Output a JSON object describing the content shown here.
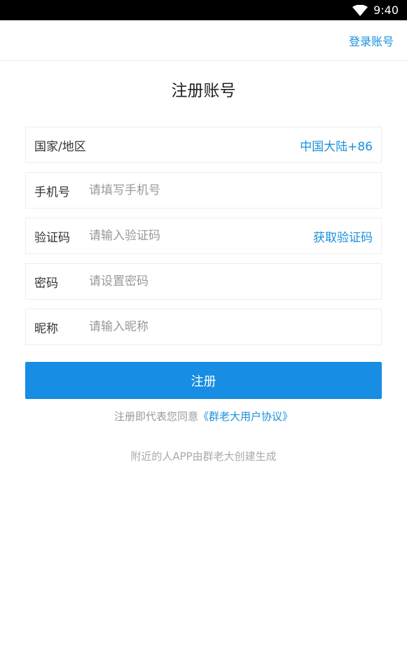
{
  "status_bar": {
    "time": "9:40"
  },
  "header": {
    "login_link": "登录账号"
  },
  "page": {
    "title": "注册账号"
  },
  "form": {
    "region": {
      "label": "国家/地区",
      "value": "中国大陆+86"
    },
    "phone": {
      "label": "手机号",
      "placeholder": "请填写手机号"
    },
    "code": {
      "label": "验证码",
      "placeholder": "请输入验证码",
      "action": "获取验证码"
    },
    "password": {
      "label": "密码",
      "placeholder": "请设置密码"
    },
    "nickname": {
      "label": "昵称",
      "placeholder": "请输入昵称"
    }
  },
  "submit": {
    "label": "注册"
  },
  "agreement": {
    "prefix": "注册即代表您同意",
    "link": "《群老大用户协议》"
  },
  "footer": {
    "note": "附近的人APP由群老大创建生成"
  },
  "colors": {
    "accent": "#1a8fdc",
    "button": "#178de3"
  },
  "icons": {
    "wifi": "wifi-icon"
  }
}
